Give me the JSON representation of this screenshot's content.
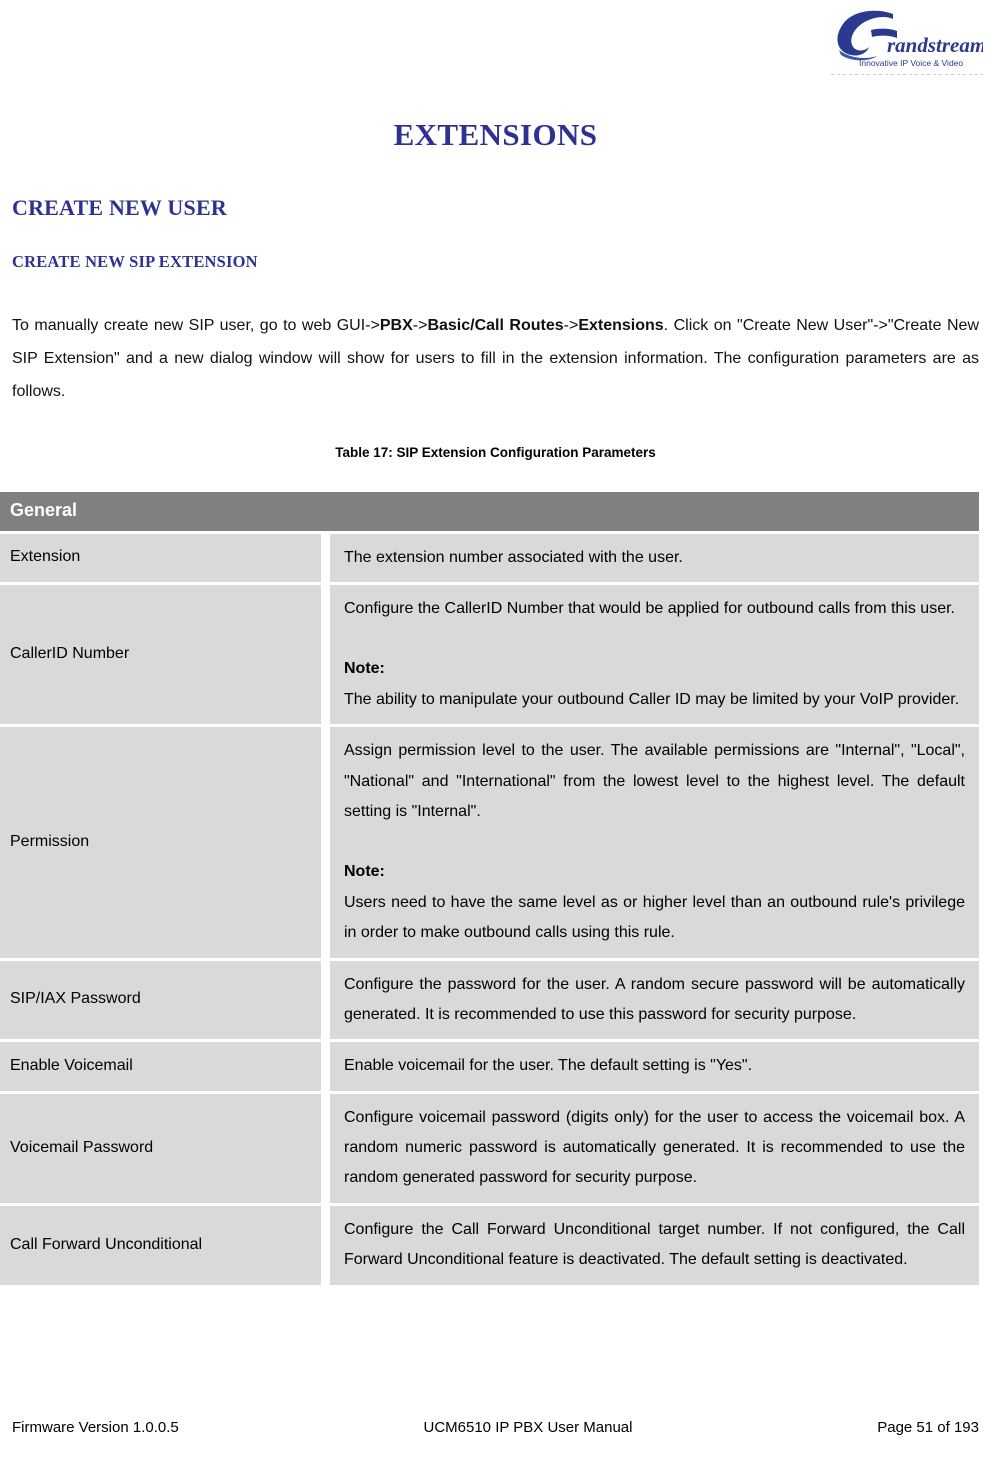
{
  "header": {
    "logo_name": "grandstream-logo",
    "logo_wordmark": "randstream",
    "logo_tagline": "Innovative IP Voice & Video",
    "brand_color": "#2b3a8f"
  },
  "document": {
    "title": "EXTENSIONS",
    "section_heading": "CREATE NEW USER",
    "subsection_heading": "CREATE NEW SIP EXTENSION",
    "intro_paragraph": {
      "part1": "To manually create new SIP user, go to web GUI->",
      "bold1": "PBX",
      "part2": "->",
      "bold2": "Basic/Call Routes",
      "part3": "->",
      "bold3": "Extensions",
      "part4": ". Click on \"Create New User\"->\"Create New SIP Extension\" and a new dialog window will show for users to fill in the extension information. The configuration parameters are as follows."
    },
    "table_caption": "Table 17: SIP Extension Configuration Parameters",
    "heading_color": "#2e3192"
  },
  "table": {
    "group_header": "General",
    "header_bg": "#808080",
    "row_bg": "#d9d9d9",
    "rows": [
      {
        "label": "Extension",
        "description": "The extension number associated with the user.",
        "note_label": "",
        "note_text": ""
      },
      {
        "label": "CallerID Number",
        "description": "Configure the CallerID Number that would be applied for outbound calls from this user.",
        "note_label": "Note:",
        "note_text": "The ability to manipulate your outbound Caller ID may be limited by your VoIP provider."
      },
      {
        "label": "Permission",
        "description": "Assign permission level to the user. The available permissions are \"Internal\", \"Local\", \"National\" and \"International\" from the lowest level to the highest level. The default setting is \"Internal\".",
        "note_label": "Note:",
        "note_text": "Users need to have the same level as or higher level than an outbound rule's privilege in order to make outbound calls using this rule."
      },
      {
        "label": "SIP/IAX Password",
        "description": "Configure the password for the user. A random secure password will be automatically generated. It is recommended to use this password for security purpose.",
        "note_label": "",
        "note_text": ""
      },
      {
        "label": "Enable Voicemail",
        "description": "Enable voicemail for the user. The default setting is \"Yes\".",
        "note_label": "",
        "note_text": ""
      },
      {
        "label": "Voicemail Password",
        "description": "Configure voicemail password (digits only) for the user to access the voicemail box. A random numeric password is automatically generated. It is recommended to use the random generated password for security purpose.",
        "note_label": "",
        "note_text": ""
      },
      {
        "label": "Call Forward Unconditional",
        "description": "Configure the Call Forward Unconditional target number. If not configured, the Call Forward Unconditional feature is deactivated. The default setting is deactivated.",
        "note_label": "",
        "note_text": ""
      }
    ]
  },
  "footer": {
    "firmware": "Firmware Version 1.0.0.5",
    "manual": "UCM6510 IP PBX User Manual",
    "page": "Page 51 of 193"
  }
}
